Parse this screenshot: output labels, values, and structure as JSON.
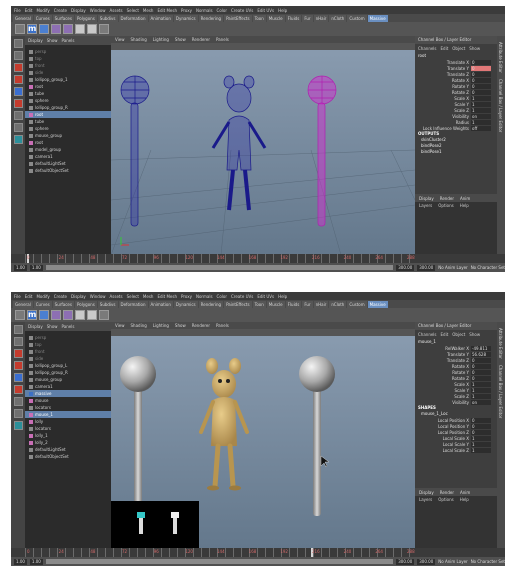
{
  "menu": [
    "File",
    "Edit",
    "Modify",
    "Create",
    "Display",
    "Window",
    "Assets",
    "Select",
    "Mesh",
    "Edit Mesh",
    "Proxy",
    "Normals",
    "Color",
    "Create UVs",
    "Edit UVs",
    "Help"
  ],
  "shelf_tabs": [
    "General",
    "Curves",
    "Surfaces",
    "Polygons",
    "Subdivs",
    "Deformation",
    "Animation",
    "Dynamics",
    "Rendering",
    "PaintEffects",
    "Toon",
    "Muscle",
    "Fluids",
    "Fur",
    "nHair",
    "nCloth",
    "Custom",
    "Massive"
  ],
  "shelf_active": "Massive",
  "outliner_menu": [
    "Display",
    "Show",
    "Panels"
  ],
  "viewport_menu": [
    "View",
    "Shading",
    "Lighting",
    "Show",
    "Renderer",
    "Panels"
  ],
  "channel_box": {
    "title": "Channel Box / Layer Editor",
    "menu": [
      "Channels",
      "Edit",
      "Object",
      "Show"
    ],
    "layer_tabs": [
      "Display",
      "Render",
      "Anim"
    ],
    "layer_menu": [
      "Layers",
      "Options",
      "Help"
    ]
  },
  "side_tabs": [
    "Attribute Editor",
    "Channel Box / Layer Editor"
  ],
  "top": {
    "outliner": [
      {
        "label": "persp",
        "cls": "dim",
        "box": ""
      },
      {
        "label": "top",
        "cls": "dim",
        "box": ""
      },
      {
        "label": "front",
        "cls": "dim",
        "box": ""
      },
      {
        "label": "side",
        "cls": "dim",
        "box": ""
      },
      {
        "label": "lollipop_group_1",
        "cls": "",
        "box": ""
      },
      {
        "label": "root",
        "cls": "",
        "box": "pink"
      },
      {
        "label": "tube",
        "cls": "",
        "box": ""
      },
      {
        "label": "sphere",
        "cls": "",
        "box": ""
      },
      {
        "label": "lollipop_group_R",
        "cls": "",
        "box": ""
      },
      {
        "label": "root",
        "cls": "sel",
        "box": "pink"
      },
      {
        "label": "tube",
        "cls": "",
        "box": ""
      },
      {
        "label": "sphere",
        "cls": "",
        "box": ""
      },
      {
        "label": "mouse_group",
        "cls": "",
        "box": ""
      },
      {
        "label": "root",
        "cls": "",
        "box": "pink"
      },
      {
        "label": "model_group",
        "cls": "",
        "box": ""
      },
      {
        "label": "camera1",
        "cls": "",
        "box": ""
      },
      {
        "label": "defaultLightSet",
        "cls": "",
        "box": ""
      },
      {
        "label": "defaultObjectSet",
        "cls": "",
        "box": ""
      }
    ],
    "object": "root",
    "channels": [
      {
        "label": "Translate X",
        "value": "0",
        "hl": false
      },
      {
        "label": "Translate Y",
        "value": "0",
        "hl": true
      },
      {
        "label": "Translate Z",
        "value": "0",
        "hl": false
      },
      {
        "label": "Rotate X",
        "value": "0",
        "hl": false
      },
      {
        "label": "Rotate Y",
        "value": "0",
        "hl": false
      },
      {
        "label": "Rotate Z",
        "value": "0",
        "hl": false
      },
      {
        "label": "Scale X",
        "value": "1",
        "hl": false
      },
      {
        "label": "Scale Y",
        "value": "1",
        "hl": false
      },
      {
        "label": "Scale Z",
        "value": "1",
        "hl": false
      },
      {
        "label": "Visibility",
        "value": "on",
        "hl": false
      },
      {
        "label": "Radius",
        "value": "1",
        "hl": false
      },
      {
        "label": "Lock Influence Weights",
        "value": "off",
        "hl": false
      }
    ],
    "outputs_title": "OUTPUTS",
    "outputs": [
      "skinCluster2",
      "bindPose2",
      "bindPose1"
    ],
    "timeline_numbers": [
      "0",
      "24",
      "48",
      "72",
      "96",
      "120",
      "144",
      "168",
      "192",
      "216",
      "240",
      "264",
      "288"
    ],
    "range": {
      "start": "1.00",
      "start2": "1.00",
      "end": "300.00",
      "end2": "300.00",
      "layer": "No Anim Layer",
      "charset": "No Character Set"
    }
  },
  "bottom": {
    "outliner": [
      {
        "label": "persp",
        "cls": "dim",
        "box": ""
      },
      {
        "label": "top",
        "cls": "dim",
        "box": ""
      },
      {
        "label": "front",
        "cls": "dim",
        "box": ""
      },
      {
        "label": "side",
        "cls": "dim",
        "box": ""
      },
      {
        "label": "lollipop_group_L",
        "cls": "",
        "box": ""
      },
      {
        "label": "lollipop_group_R",
        "cls": "",
        "box": ""
      },
      {
        "label": "mouse_group",
        "cls": "",
        "box": ""
      },
      {
        "label": "camera1",
        "cls": "",
        "box": ""
      },
      {
        "label": "massive",
        "cls": "sel",
        "box": "blue"
      },
      {
        "label": "mouse",
        "cls": "",
        "box": "pink"
      },
      {
        "label": "locators",
        "cls": "",
        "box": ""
      },
      {
        "label": "mouse_1",
        "cls": "sel",
        "box": "pink"
      },
      {
        "label": "lolly",
        "cls": "",
        "box": "pink"
      },
      {
        "label": "locators",
        "cls": "",
        "box": ""
      },
      {
        "label": "lolly_1",
        "cls": "",
        "box": "pink"
      },
      {
        "label": "lolly_2",
        "cls": "",
        "box": "pink"
      },
      {
        "label": "defaultLightSet",
        "cls": "",
        "box": ""
      },
      {
        "label": "defaultObjectSet",
        "cls": "",
        "box": ""
      }
    ],
    "object": "mouse_1",
    "channels": [
      {
        "label": "RelWalker X",
        "value": "-49.811",
        "hl": false
      },
      {
        "label": "Translate Y",
        "value": "56.628",
        "hl": false
      },
      {
        "label": "Translate Z",
        "value": "0",
        "hl": false
      },
      {
        "label": "Rotate X",
        "value": "0",
        "hl": false
      },
      {
        "label": "Rotate Y",
        "value": "0",
        "hl": false
      },
      {
        "label": "Rotate Z",
        "value": "0",
        "hl": false
      },
      {
        "label": "Scale X",
        "value": "1",
        "hl": false
      },
      {
        "label": "Scale Y",
        "value": "1",
        "hl": false
      },
      {
        "label": "Scale Z",
        "value": "1",
        "hl": false
      },
      {
        "label": "Visibility",
        "value": "on",
        "hl": false
      }
    ],
    "shapes_title": "SHAPES",
    "shape_node": "mouse_1_Loc",
    "shape_channels": [
      {
        "label": "Local Position X",
        "value": "0"
      },
      {
        "label": "Local Position Y",
        "value": "0"
      },
      {
        "label": "Local Position Z",
        "value": "0"
      },
      {
        "label": "Local Scale X",
        "value": "1"
      },
      {
        "label": "Local Scale Y",
        "value": "1"
      },
      {
        "label": "Local Scale Z",
        "value": "1"
      }
    ],
    "timeline_numbers": [
      "0",
      "24",
      "48",
      "72",
      "96",
      "120",
      "144",
      "168",
      "192",
      "216",
      "240",
      "264",
      "288"
    ],
    "range": {
      "start": "1.00",
      "start2": "1.00",
      "end": "300.00",
      "end2": "300.00",
      "layer": "No Anim Layer",
      "charset": "No Character Set"
    }
  }
}
